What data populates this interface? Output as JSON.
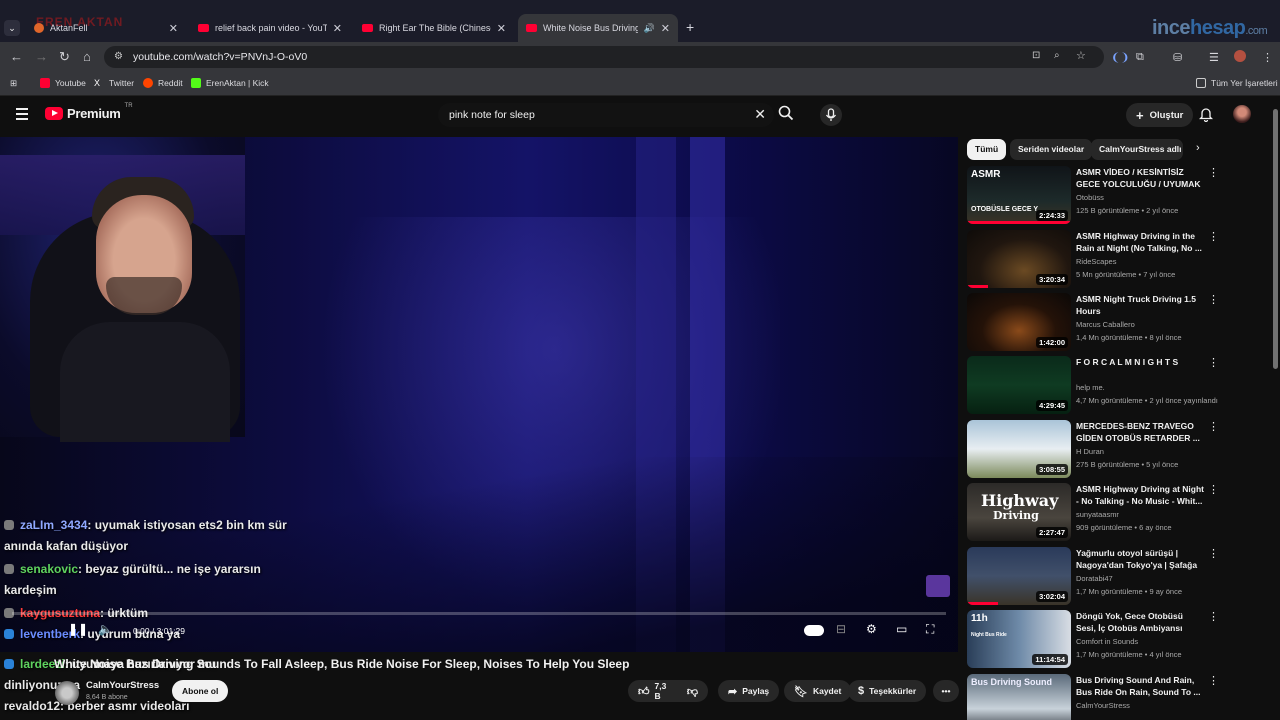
{
  "browser": {
    "tabs": [
      {
        "title": "AktanFell"
      },
      {
        "title": "relief back pain video - YouTube"
      },
      {
        "title": "Right Ear The Bible (Chinese), Left"
      },
      {
        "title": "White Noise Bus Driving Soun"
      }
    ],
    "url": "youtube.com/watch?v=PNVnJ-O-oV0",
    "watermark": {
      "prefix": "ince",
      "accent": "hesap",
      "suffix": ".com"
    },
    "streamer_watermark": "EREN AKTAN",
    "bookmarks": [
      {
        "label": "Youtube",
        "color": "#ff0033"
      },
      {
        "label": "Twitter",
        "color": "#ffffff"
      },
      {
        "label": "Reddit",
        "color": "#ff4500"
      },
      {
        "label": "ErenAktan | Kick",
        "color": "#53fc18"
      }
    ],
    "all_bookmarks": "Tüm Yer İşaretleri"
  },
  "youtube": {
    "logo": "Premium",
    "logo_region": "TR",
    "search_query": "pink note for sleep",
    "create_label": "Oluştur"
  },
  "player": {
    "time": "0:00 / 3:01:29",
    "progress": 0,
    "chat": [
      {
        "user": "zaLIm_3434",
        "user_color": "#8fa8ff",
        "text": ": uyumak istiyosan ets2 bin km sür anında kafan düşüyor"
      },
      {
        "user": "senakovic",
        "user_color": "#5fd35f",
        "text": ": beyaz gürültü... ne işe yararsın kardeşim"
      },
      {
        "user": "kaygusuztuna",
        "user_color": "#ff3b3b",
        "text": ": ürktüm"
      },
      {
        "user": "leventberk",
        "user_color": "#6a8cff",
        "text": ": uyurum buna ya"
      },
      {
        "user": "lardeezi",
        "user_color": "#5fd35f",
        "text": ": uyumaya hazırlanıyor mu dinliyonuz ya"
      },
      {
        "user": "revaldo12",
        "user_color": "#e8e8e8",
        "text": ": berber asmr videoları"
      }
    ]
  },
  "video": {
    "title": "White Noise Bus Driving Sounds To Fall Asleep, Bus Ride Noise For Sleep, Noises To Help You Sleep",
    "channel": "CalmYourStress",
    "subscribers": "8,64 B abone",
    "subscribe_label": "Abone ol",
    "likes": "7,3 B",
    "share_label": "Paylaş",
    "save_label": "Kaydet",
    "thanks_label": "Teşekkürler"
  },
  "sidebar": {
    "chips": [
      "Tümü",
      "Seriden videolar",
      "CalmYourStress adlı"
    ],
    "recommendations": [
      {
        "title": "ASMR VİDEO / KESİNTİSİZ GECE YOLCULUĞU / UYUMAK ...",
        "channel": "Otobüss",
        "meta": "125 B görüntüleme • 2 yıl önce",
        "duration": "2:24:33",
        "thumb_text": "ASMR",
        "thumb_sub": "OTOBÜSLE GECE Y",
        "watched": 1.0,
        "bg": "linear-gradient(180deg,#101418,#1d2a2a 60%,#3b3326)"
      },
      {
        "title": "ASMR Highway Driving in the Rain at Night (No Talking, No ...",
        "channel": "RideScapes",
        "meta": "5 Mn görüntüleme • 7 yıl önce",
        "duration": "3:20:34",
        "thumb_text": "",
        "thumb_sub": "",
        "watched": 0.2,
        "bg": "radial-gradient(ellipse at 55% 70%,#6b4a23,#20160f 55%,#0e0b09)"
      },
      {
        "title": "ASMR Night Truck Driving 1.5 Hours",
        "channel": "Marcus Caballero",
        "meta": "1,4 Mn görüntüleme • 8 yıl önce",
        "duration": "1:42:00",
        "thumb_text": "",
        "thumb_sub": "",
        "watched": 0,
        "bg": "radial-gradient(ellipse at 50% 65%,#8a4a1a,#241208 50%,#0b0807)"
      },
      {
        "title": "F O R   C A L M   N I G H T S",
        "channel": "help me.",
        "meta": "4,7 Mn görüntüleme • 2 yıl önce yayınlandı",
        "duration": "4:29:45",
        "thumb_text": "",
        "thumb_sub": "",
        "watched": 0,
        "bg": "linear-gradient(180deg,#0a2a1a,#0f3b22 50%,#062011)"
      },
      {
        "title": "MERCEDES-BENZ TRAVEGO GİDEN OTOBÜS RETARDER ...",
        "channel": "H Duran",
        "meta": "275 B görüntüleme • 5 yıl önce",
        "duration": "3:08:55",
        "thumb_text": "",
        "thumb_sub": "",
        "watched": 0,
        "bg": "linear-gradient(180deg,#aac4d8,#e8eef2 50%,#7c8a5c)"
      },
      {
        "title": "ASMR Highway Driving at Night - No Talking - No Music - Whit...",
        "channel": "sunyataasmr",
        "meta": "909 görüntüleme • 6 ay önce",
        "duration": "2:27:47",
        "thumb_text": "Highway",
        "thumb_sub": "Driving",
        "watched": 0,
        "bg": "linear-gradient(180deg,#2c2a28,#4a453e 60%,#1c1a18)"
      },
      {
        "title": "Yağmurlu otoyol sürüşü | Nagoya'dan Tokyo'ya | Şafağa ...",
        "channel": "Doratabi47",
        "meta": "1,7 Mn görüntüleme • 9 ay önce",
        "duration": "3:02:04",
        "thumb_text": "",
        "thumb_sub": "",
        "watched": 0.3,
        "bg": "linear-gradient(180deg,#2a3a5a,#41506a 50%,#3a3428)"
      },
      {
        "title": "Döngü Yok, Gece Otobüsü Sesi, İç Otobüs Ambiyansı Organik ...",
        "channel": "Comfort in Sounds",
        "meta": "1,7 Mn görüntüleme • 4 yıl önce",
        "duration": "11:14:54",
        "thumb_text": "11h",
        "thumb_sub": "Night Bus Ride",
        "watched": 0,
        "bg": "linear-gradient(90deg,#2a3e58,#6e8aa8 50%,#d8dde4)"
      },
      {
        "title": "Bus Driving Sound And Rain, Bus Ride On Rain, Sound To ...",
        "channel": "CalmYourStress",
        "meta": "",
        "duration": "",
        "thumb_text": "Bus Driving Sound",
        "thumb_sub": "",
        "watched": 0,
        "bg": "linear-gradient(180deg,#5a6a7a,#c8d2da 60%,#2a3038)"
      }
    ]
  }
}
